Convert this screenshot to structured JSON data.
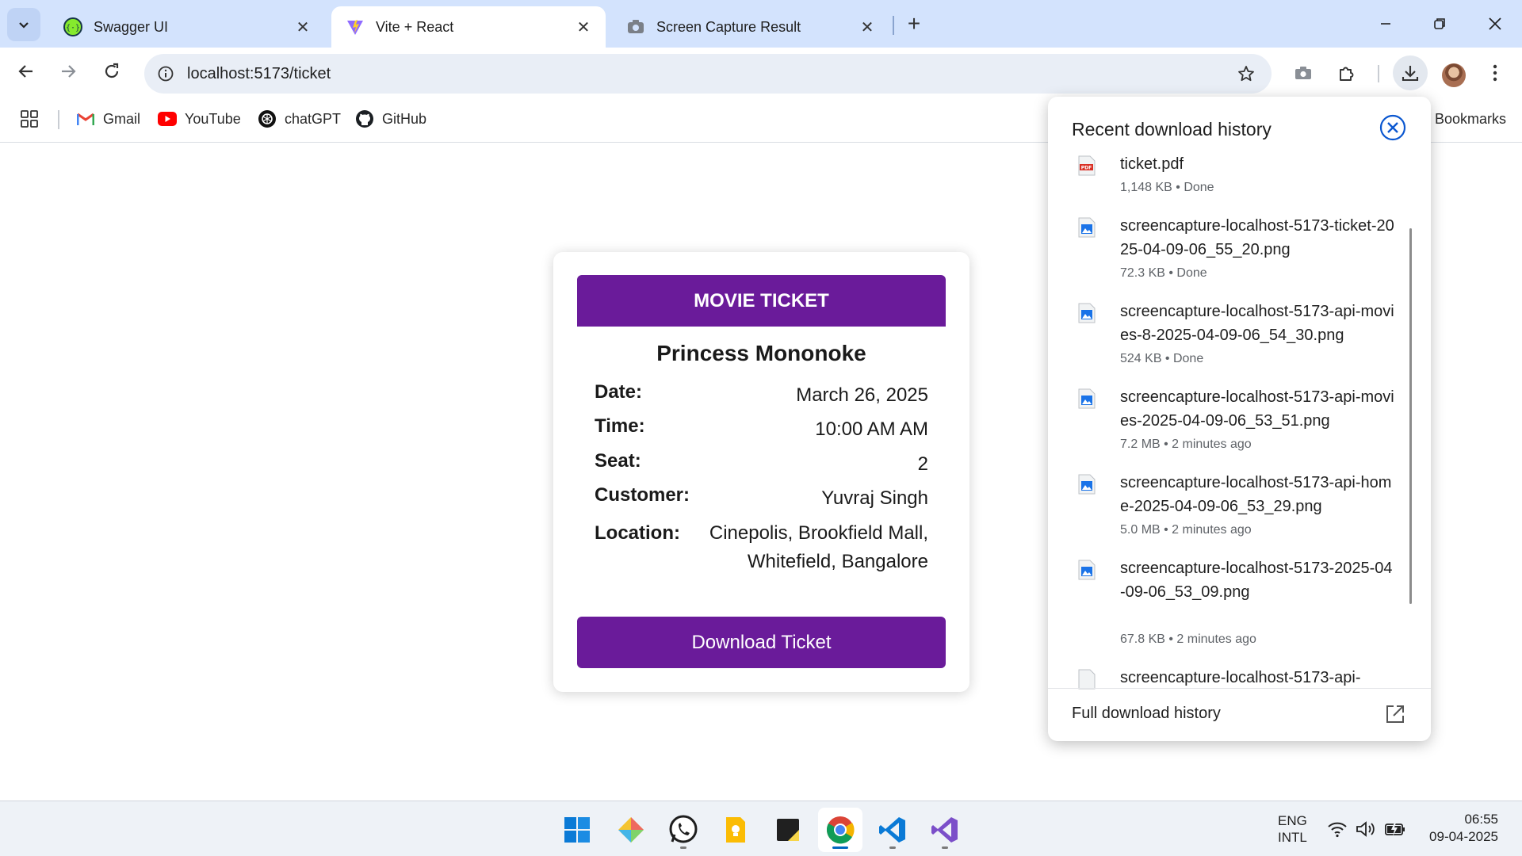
{
  "browser": {
    "tabs": [
      {
        "title": "Swagger UI",
        "active": false
      },
      {
        "title": "Vite + React",
        "active": true
      },
      {
        "title": "Screen Capture Result",
        "active": false
      }
    ],
    "url": "localhost:5173/ticket",
    "bookmarks": [
      {
        "label": "Gmail",
        "icon": "gmail-icon"
      },
      {
        "label": "YouTube",
        "icon": "youtube-icon"
      },
      {
        "label": "chatGPT",
        "icon": "chatgpt-icon"
      },
      {
        "label": "GitHub",
        "icon": "github-icon"
      }
    ],
    "all_bookmarks_label": "Bookmarks"
  },
  "ticket": {
    "header": "MOVIE TICKET",
    "movie": "Princess Mononoke",
    "fields": [
      {
        "label": "Date:",
        "value": "March 26, 2025"
      },
      {
        "label": "Time:",
        "value": "10:00 AM AM"
      },
      {
        "label": "Seat:",
        "value": "2"
      },
      {
        "label": "Customer:",
        "value": "Yuvraj Singh"
      },
      {
        "label": "Location:",
        "value_line1": "Cinepolis, Brookfield Mall,",
        "value_line2": "Whitefield, Bangalore"
      }
    ],
    "download_label": "Download Ticket",
    "accent": "#6a1b9a"
  },
  "downloads": {
    "title": "Recent download history",
    "items": [
      {
        "name": "ticket.pdf",
        "meta": "1,148 KB • Done",
        "type": "pdf"
      },
      {
        "name": "screencapture-localhost-5173-ticket-2025-04-09-06_55_20.png",
        "meta": "72.3 KB • Done",
        "type": "image"
      },
      {
        "name": "screencapture-localhost-5173-api-movies-8-2025-04-09-06_54_30.png",
        "meta": "524 KB • Done",
        "type": "image"
      },
      {
        "name": "screencapture-localhost-5173-api-movies-2025-04-09-06_53_51.png",
        "meta": "7.2 MB • 2 minutes ago",
        "type": "image"
      },
      {
        "name": "screencapture-localhost-5173-api-home-2025-04-09-06_53_29.png",
        "meta": "5.0 MB • 2 minutes ago",
        "type": "image"
      },
      {
        "name": "screencapture-localhost-5173-2025-04-09-06_53_09.png",
        "meta": "67.8 KB • 2 minutes ago",
        "type": "image"
      },
      {
        "name": "screencapture-localhost-5173-api-",
        "meta": "",
        "type": "image"
      }
    ],
    "footer": "Full download history"
  },
  "taskbar": {
    "apps": [
      "windows-start-icon",
      "gitkraken-icon",
      "whatsapp-icon",
      "keep-icon",
      "sticky-notes-icon",
      "chrome-icon",
      "vscode-icon",
      "visual-studio-icon"
    ],
    "lang_line1": "ENG",
    "lang_line2": "INTL",
    "time": "06:55",
    "date": "09-04-2025"
  }
}
